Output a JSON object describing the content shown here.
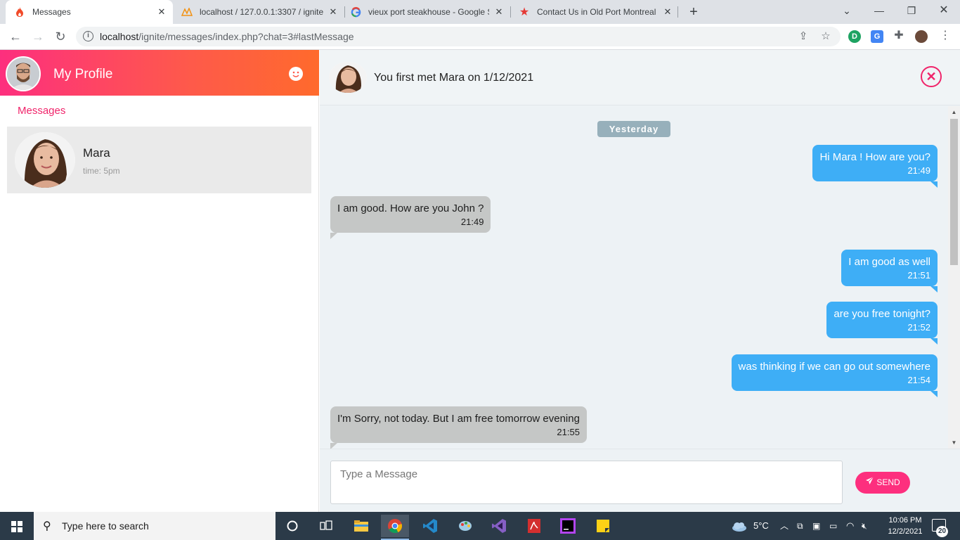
{
  "browser": {
    "tabs": [
      {
        "title": "Messages",
        "icon": "flame-icon",
        "active": true
      },
      {
        "title": "localhost / 127.0.0.1:3307 / ignite",
        "icon": "phpmyadmin-icon",
        "active": false
      },
      {
        "title": "vieux port steakhouse - Google S",
        "icon": "google-icon",
        "active": false
      },
      {
        "title": "Contact Us in Old Port Montreal",
        "icon": "star-icon",
        "active": false
      }
    ],
    "url_host": "localhost",
    "url_path": "/ignite/messages/index.php?chat=3#lastMessage",
    "extension_labels": [
      "D",
      "G"
    ]
  },
  "sidebar": {
    "profile_title": "My Profile",
    "section_label": "Messages",
    "contacts": [
      {
        "name": "Mara",
        "time": "time: 5pm"
      }
    ]
  },
  "chat": {
    "header_text": "You first met Mara on 1/12/2021",
    "date_badge": "Yesterday",
    "messages": [
      {
        "direction": "out",
        "text": "Hi Mara ! How are you?",
        "time": "21:49"
      },
      {
        "direction": "in",
        "text": "I am good. How are you John ?",
        "time": "21:49"
      },
      {
        "direction": "out",
        "text": "I am good as well",
        "time": "21:51"
      },
      {
        "direction": "out",
        "text": "are you free tonight?",
        "time": "21:52"
      },
      {
        "direction": "out",
        "text": "was thinking if we can go out somewhere",
        "time": "21:54"
      },
      {
        "direction": "in",
        "text": "I'm Sorry, not today. But I am free tomorrow evening",
        "time": "21:55"
      }
    ],
    "input_placeholder": "Type a Message",
    "send_label": "SEND"
  },
  "colors": {
    "accent_pink": "#fd2f7e",
    "outgoing_bubble": "#3eaef6",
    "incoming_bubble": "#c5c7c6"
  },
  "taskbar": {
    "search_placeholder": "Type here to search",
    "weather": "5°C",
    "time": "10:06 PM",
    "date": "12/2/2021",
    "notification_count": "20",
    "apps": [
      "cortana-icon",
      "task-view-icon",
      "file-explorer-icon",
      "chrome-icon",
      "vscode-icon",
      "paint-icon",
      "visual-studio-icon",
      "acrobat-icon",
      "phpstorm-icon",
      "sticky-notes-icon"
    ]
  }
}
